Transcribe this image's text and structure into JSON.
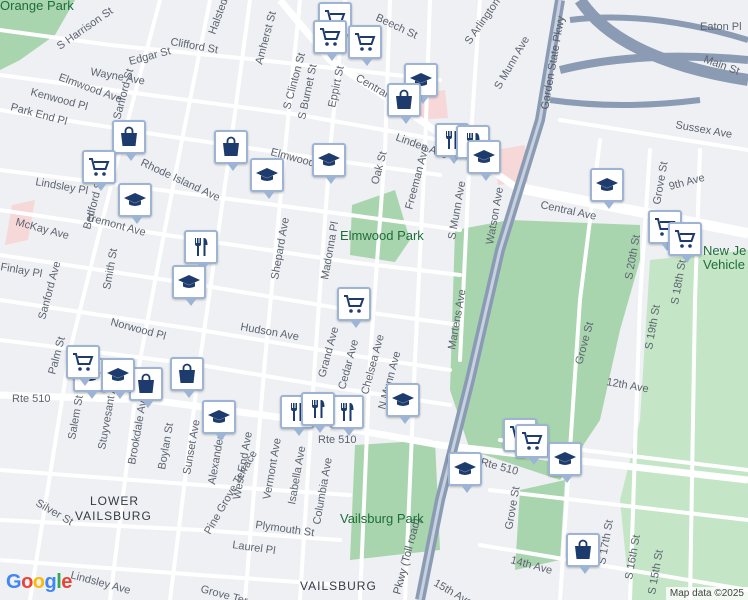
{
  "map": {
    "colors": {
      "land": "#eef0f3",
      "street": "#ffffff",
      "park": "#a8d5ae",
      "park_light": "#c4e6c6",
      "highway": "#8a9bb3",
      "pin_border": "#9eb4d4",
      "pin_icon": "#1e3b6e"
    },
    "streets": [
      "S Harrison St",
      "Halsted St",
      "Clifford St",
      "Amherst St",
      "S Clinton St",
      "Beech St",
      "S Arlington",
      "Wayne Ave",
      "Edgar St",
      "Elmwood Ave",
      "Sanford St",
      "S Burnet St",
      "Eppirt St",
      "Central",
      "Kenwood Pl",
      "Park End Pl",
      "Linden Ave",
      "S Munn Ave",
      "Rhode Island Ave",
      "Elmwood Ave",
      "Oak St",
      "Freeman Ave",
      "Lindsley Pl",
      "Bedford St",
      "Central Ave",
      "McKay Ave",
      "Tremont Ave",
      "Madonna Pl",
      "Shepard Ave",
      "S Munn Ave",
      "Watson Ave",
      "Smith St",
      "Finlay Pl",
      "Norwood Pl",
      "Hudson Ave",
      "Martens Ave",
      "Sanford Ave",
      "Palm St",
      "Grand Ave",
      "Cedar Ave",
      "Chelsea Ave",
      "N Munn Ave",
      "Rte 510",
      "Rte 510",
      "Stuyvesant Ave",
      "Salem St",
      "Brookdale Ave",
      "Boylan St",
      "Sunset Ave",
      "Alexander St",
      "Pine Grove Terrace",
      "West End Ave",
      "Vermont Ave",
      "Isabella Ave",
      "Columbia Ave",
      "Plymouth St",
      "Laurel Pl",
      "Silver St",
      "Lindsley Ave",
      "Grove Ter",
      "Garden State Pkwy",
      "Eaton Pl",
      "Main St",
      "Sussex Ave",
      "9th Ave",
      "Grove St",
      "S 20th St",
      "S 19th St",
      "S 18th St",
      "Grove St",
      "12th Ave",
      "Rte 510",
      "Grove St",
      "14th Ave",
      "S 17th St",
      "S 16th St",
      "S 15th St",
      "15th Ave",
      "Pkwy (Toll road)",
      "Orange Park"
    ],
    "places": [
      "Elmwood Park",
      "LOWER",
      "VAILSBURG",
      "Vailsburg Park",
      "VAILSBURG",
      "New Je",
      "Vehicle"
    ],
    "pins": [
      {
        "icon": "cart-icon"
      },
      {
        "icon": "cart-icon"
      },
      {
        "icon": "cart-icon"
      },
      {
        "icon": "grad-cap-icon"
      },
      {
        "icon": "shopping-bag-icon"
      },
      {
        "icon": "shopping-bag-icon"
      },
      {
        "icon": "cart-icon"
      },
      {
        "icon": "shopping-bag-icon"
      },
      {
        "icon": "grad-cap-icon"
      },
      {
        "icon": "grad-cap-icon"
      },
      {
        "icon": "fork-knife-icon"
      },
      {
        "icon": "fork-knife-icon"
      },
      {
        "icon": "grad-cap-icon"
      },
      {
        "icon": "grad-cap-icon"
      },
      {
        "icon": "fork-knife-icon"
      },
      {
        "icon": "grad-cap-icon"
      },
      {
        "icon": "cart-icon"
      },
      {
        "icon": "grad-cap-icon"
      },
      {
        "icon": "cart-icon"
      },
      {
        "icon": "cart-icon"
      },
      {
        "icon": "grad-cap-icon"
      },
      {
        "icon": "shopping-bag-icon"
      },
      {
        "icon": "shopping-bag-icon"
      },
      {
        "icon": "grad-cap-icon"
      },
      {
        "icon": "cart-icon"
      },
      {
        "icon": "fork-knife-icon"
      },
      {
        "icon": "fork-knife-icon"
      },
      {
        "icon": "fork-knife-icon"
      },
      {
        "icon": "grad-cap-icon"
      },
      {
        "icon": "cart-icon"
      },
      {
        "icon": "cart-icon"
      },
      {
        "icon": "grad-cap-icon"
      },
      {
        "icon": "grad-cap-icon"
      },
      {
        "icon": "shopping-bag-icon"
      },
      {
        "icon": "grad-cap-icon"
      }
    ],
    "attribution": "Map data ©2025",
    "logo": "Google"
  }
}
